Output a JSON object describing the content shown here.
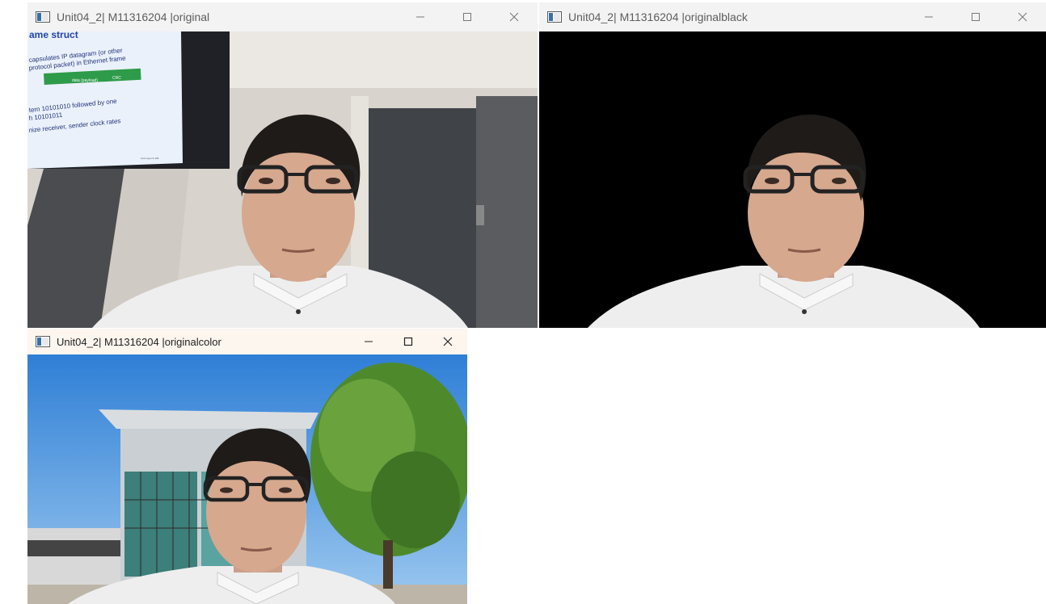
{
  "windows": [
    {
      "title": "Unit04_2| M11316204 |original",
      "controls": {
        "minimize": "—",
        "maximize": "☐",
        "close": "✕"
      }
    },
    {
      "title": "Unit04_2| M11316204 |originalblack",
      "controls": {
        "minimize": "—",
        "maximize": "☐",
        "close": "✕"
      }
    },
    {
      "title": "Unit04_2| M11316204 |originalcolor",
      "controls": {
        "minimize": "—",
        "maximize": "☐",
        "close": "✕"
      }
    }
  ],
  "slide": {
    "heading": "ame struct",
    "line1": "capsulates IP datagram (or other",
    "line2": "protocol packet) in Ethernet frame",
    "bar_labels": [
      "data (payload)",
      "CRC"
    ],
    "line3": "tern 10101010 followed by one",
    "line4": "h 10101011",
    "line5": "nize receiver, sender clock rates",
    "footer": "Link Layer 6-106"
  }
}
